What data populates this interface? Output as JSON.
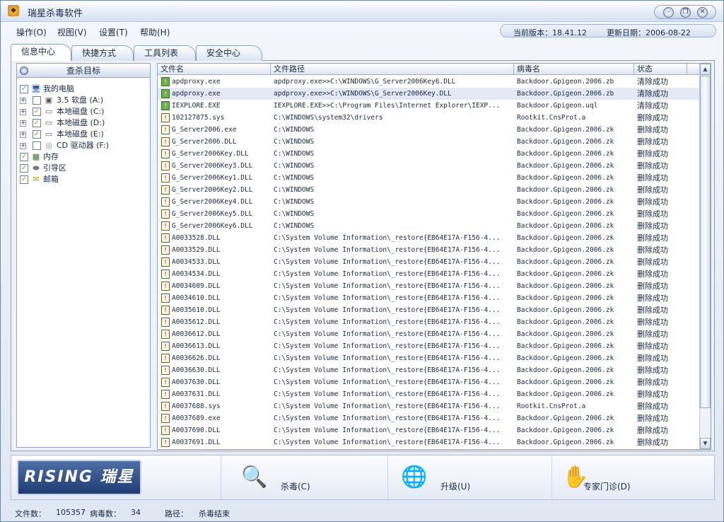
{
  "window": {
    "title": "瑞星杀毒软件"
  },
  "menu": [
    "操作(O)",
    "视图(V)",
    "设置(T)",
    "帮助(H)"
  ],
  "version": {
    "label": "当前版本：18.41.12",
    "date_label": "更新日期：2006-08-22"
  },
  "tabs": [
    "信息中心",
    "快捷方式",
    "工具列表",
    "安全中心"
  ],
  "tree": {
    "header": "查杀目标",
    "items": [
      {
        "label": "我的电脑",
        "icon": "computer-icon",
        "checked": "partial"
      },
      {
        "label": "3.5 软盘 (A:)",
        "icon": "floppy-icon",
        "checked": "no"
      },
      {
        "label": "本地磁盘 (C:)",
        "icon": "harddisk-icon",
        "checked": "yes"
      },
      {
        "label": "本地磁盘 (D:)",
        "icon": "harddisk-icon",
        "checked": "yes"
      },
      {
        "label": "本地磁盘 (E:)",
        "icon": "harddisk-icon",
        "checked": "yes"
      },
      {
        "label": "CD 驱动器 (F:)",
        "icon": "cd-icon",
        "checked": "no"
      },
      {
        "label": "内存",
        "icon": "memory-icon",
        "checked": "yes"
      },
      {
        "label": "引导区",
        "icon": "boot-icon",
        "checked": "yes"
      },
      {
        "label": "邮箱",
        "icon": "mail-icon",
        "checked": "yes"
      }
    ]
  },
  "results": {
    "columns": [
      "文件名",
      "文件路径",
      "病毒名",
      "状态"
    ],
    "rows": [
      [
        "apdproxy.exe",
        "apdproxy.exe>>C:\\WINDOWS\\G_Server2006Key6.DLL",
        "Backdoor.Gpigeon.2006.zb",
        "清除成功"
      ],
      [
        "apdproxy.exe",
        "apdproxy.exe>>C:\\WINDOWS\\G_Server2006Key.DLL",
        "Backdoor.Gpigeon.2006.zb",
        "清除成功"
      ],
      [
        "IEXPLORE.EXE",
        "IEXPLORE.EXE>>C:\\Program Files\\Internet Explorer\\IEXP...",
        "Backdoor.Gpigeon.uql",
        "清除成功"
      ],
      [
        "102127875.sys",
        "C:\\WINDOWS\\system32\\drivers",
        "Rootkit.CnsProt.a",
        "删除成功"
      ],
      [
        "G_Server2006.exe",
        "C:\\WINDOWS",
        "Backdoor.Gpigeon.2006.zk",
        "删除成功"
      ],
      [
        "G_Server2006.DLL",
        "C:\\WINDOWS",
        "Backdoor.Gpigeon.2006.zk",
        "删除成功"
      ],
      [
        "G_Server2006Key.DLL",
        "C:\\WINDOWS",
        "Backdoor.Gpigeon.2006.zk",
        "删除成功"
      ],
      [
        "G_Server2006Key3.DLL",
        "C:\\WINDOWS",
        "Backdoor.Gpigeon.2006.zk",
        "删除成功"
      ],
      [
        "G_Server2006Key1.DLL",
        "C:\\WINDOWS",
        "Backdoor.Gpigeon.2006.zk",
        "删除成功"
      ],
      [
        "G_Server2006Key2.DLL",
        "C:\\WINDOWS",
        "Backdoor.Gpigeon.2006.zk",
        "删除成功"
      ],
      [
        "G_Server2006Key4.DLL",
        "C:\\WINDOWS",
        "Backdoor.Gpigeon.2006.zk",
        "删除成功"
      ],
      [
        "G_Server2006Key5.DLL",
        "C:\\WINDOWS",
        "Backdoor.Gpigeon.2006.zk",
        "删除成功"
      ],
      [
        "G_Server2006Key6.DLL",
        "C:\\WINDOWS",
        "Backdoor.Gpigeon.2006.zk",
        "删除成功"
      ],
      [
        "A0033528.DLL",
        "C:\\System Volume Information\\_restore{EB64E17A-F156-4...",
        "Backdoor.Gpigeon.2006.zk",
        "删除成功"
      ],
      [
        "A0033529.DLL",
        "C:\\System Volume Information\\_restore{EB64E17A-F156-4...",
        "Backdoor.Gpigeon.2006.zk",
        "删除成功"
      ],
      [
        "A0034533.DLL",
        "C:\\System Volume Information\\_restore{EB64E17A-F156-4...",
        "Backdoor.Gpigeon.2006.zk",
        "删除成功"
      ],
      [
        "A0034534.DLL",
        "C:\\System Volume Information\\_restore{EB64E17A-F156-4...",
        "Backdoor.Gpigeon.2006.zk",
        "删除成功"
      ],
      [
        "A0034609.DLL",
        "C:\\System Volume Information\\_restore{EB64E17A-F156-4...",
        "Backdoor.Gpigeon.2006.zk",
        "删除成功"
      ],
      [
        "A0034610.DLL",
        "C:\\System Volume Information\\_restore{EB64E17A-F156-4...",
        "Backdoor.Gpigeon.2006.zk",
        "删除成功"
      ],
      [
        "A0035610.DLL",
        "C:\\System Volume Information\\_restore{EB64E17A-F156-4...",
        "Backdoor.Gpigeon.2006.zk",
        "删除成功"
      ],
      [
        "A0035612.DLL",
        "C:\\System Volume Information\\_restore{EB64E17A-F156-4...",
        "Backdoor.Gpigeon.2006.zk",
        "删除成功"
      ],
      [
        "A0036612.DLL",
        "C:\\System Volume Information\\_restore{EB64E17A-F156-4...",
        "Backdoor.Gpigeon.2006.zk",
        "删除成功"
      ],
      [
        "A0036613.DLL",
        "C:\\System Volume Information\\_restore{EB64E17A-F156-4...",
        "Backdoor.Gpigeon.2006.zk",
        "删除成功"
      ],
      [
        "A0036626.DLL",
        "C:\\System Volume Information\\_restore{EB64E17A-F156-4...",
        "Backdoor.Gpigeon.2006.zk",
        "删除成功"
      ],
      [
        "A0036630.DLL",
        "C:\\System Volume Information\\_restore{EB64E17A-F156-4...",
        "Backdoor.Gpigeon.2006.zk",
        "删除成功"
      ],
      [
        "A0037630.DLL",
        "C:\\System Volume Information\\_restore{EB64E17A-F156-4...",
        "Backdoor.Gpigeon.2006.zk",
        "删除成功"
      ],
      [
        "A0037631.DLL",
        "C:\\System Volume Information\\_restore{EB64E17A-F156-4...",
        "Backdoor.Gpigeon.2006.zk",
        "删除成功"
      ],
      [
        "A0037688.sys",
        "C:\\System Volume Information\\_restore{EB64E17A-F156-4...",
        "Rootkit.CnsProt.a",
        "删除成功"
      ],
      [
        "A0037689.exe",
        "C:\\System Volume Information\\_restore{EB64E17A-F156-4...",
        "Backdoor.Gpigeon.2006.zk",
        "删除成功"
      ],
      [
        "A0037690.DLL",
        "C:\\System Volume Information\\_restore{EB64E17A-F156-4...",
        "Backdoor.Gpigeon.2006.zk",
        "删除成功"
      ],
      [
        "A0037691.DLL",
        "C:\\System Volume Information\\_restore{EB64E17A-F156-4...",
        "Backdoor.Gpigeon.2006.zk",
        "删除成功"
      ]
    ]
  },
  "actions": {
    "logo": "RISING 瑞星",
    "scan_label": "杀毒(C)",
    "upgrade_label": "升级(U)",
    "expert_label": "专家门诊(D)"
  },
  "status": {
    "files_label": "文件数：",
    "files_value": "105357",
    "virus_label": "病毒数：",
    "virus_value": "34",
    "path_label": "路径：",
    "path_value": "杀毒结束"
  },
  "colors": {
    "accent": "#1f3b73",
    "panel": "#eef2f9",
    "border": "#8aa0c4"
  }
}
